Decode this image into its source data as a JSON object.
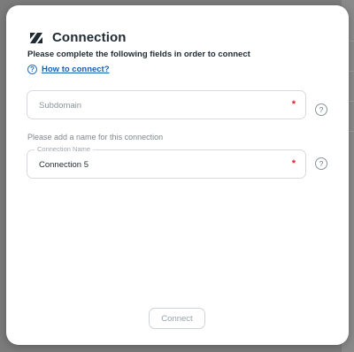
{
  "modal": {
    "title": "Connection",
    "subtitle": "Please complete the following fields in order to connect",
    "help_link": "How to connect?",
    "help_glyph": "?",
    "logo_icon": "zendesk-logo-icon"
  },
  "fields": {
    "subdomain": {
      "placeholder": "Subdomain",
      "required_mark": "*",
      "help_glyph": "?"
    },
    "connection_name": {
      "hint": "Please add a name for this connection",
      "label": "Connection Name",
      "value": "Connection 5",
      "required_mark": "*",
      "help_glyph": "?"
    }
  },
  "actions": {
    "connect_label": "Connect"
  },
  "colors": {
    "link": "#1a5fb4",
    "required": "#e0202a",
    "backdrop": "#7b7b7b"
  }
}
